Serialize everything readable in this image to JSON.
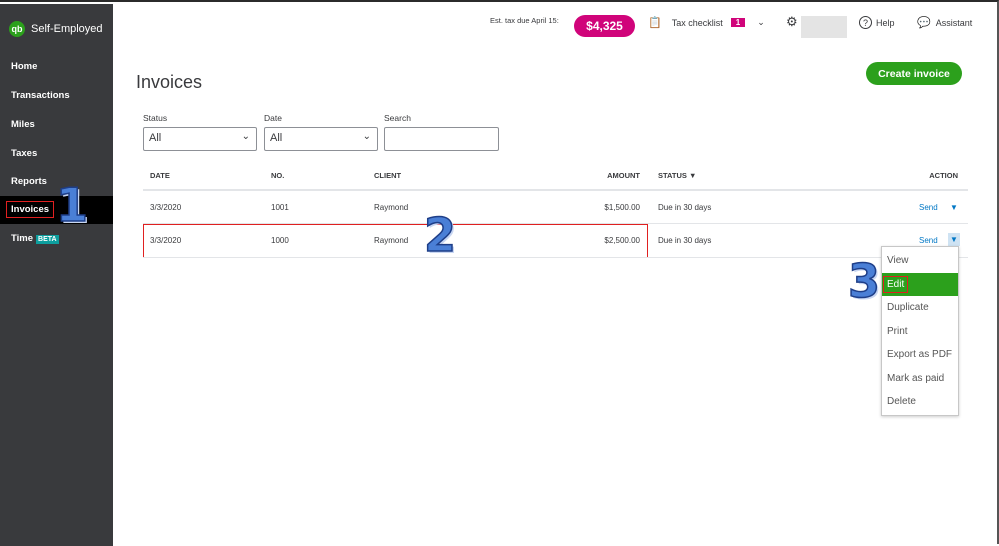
{
  "app": {
    "logo": "qb",
    "name": "Self-Employed"
  },
  "sidebar": {
    "items": [
      {
        "label": "Home"
      },
      {
        "label": "Transactions"
      },
      {
        "label": "Miles"
      },
      {
        "label": "Taxes"
      },
      {
        "label": "Reports"
      },
      {
        "label": "Invoices",
        "active": true
      },
      {
        "label": "Time",
        "badge": "BETA"
      }
    ]
  },
  "header": {
    "est_tax_label": "Est. tax due April 15:",
    "est_tax_value": "$4,325",
    "tax_checklist": "Tax checklist",
    "checklist_count": "1",
    "help": "Help",
    "assistant": "Assistant"
  },
  "page": {
    "title": "Invoices",
    "create_button": "Create invoice"
  },
  "filters": {
    "status_label": "Status",
    "status_value": "All",
    "date_label": "Date",
    "date_value": "All",
    "search_label": "Search",
    "search_value": ""
  },
  "table": {
    "columns": [
      "DATE",
      "NO.",
      "CLIENT",
      "AMOUNT",
      "STATUS ▼",
      "ACTION"
    ],
    "rows": [
      {
        "date": "3/3/2020",
        "no": "1001",
        "client": "Raymond",
        "amount": "$1,500.00",
        "status": "Due in 30 days",
        "action": "Send"
      },
      {
        "date": "3/3/2020",
        "no": "1000",
        "client": "Raymond",
        "amount": "$2,500.00",
        "status": "Due in 30 days",
        "action": "Send"
      }
    ]
  },
  "action_menu": {
    "items": [
      "View",
      "Edit",
      "Duplicate",
      "Print",
      "Export as PDF",
      "Mark as paid",
      "Delete"
    ],
    "active": "Edit"
  },
  "annotations": [
    "1",
    "2",
    "3"
  ],
  "colors": {
    "sidebar": "#393a3d",
    "accent": "#2ca01c",
    "tax_pill": "#d0047a",
    "link": "#0077c5"
  }
}
